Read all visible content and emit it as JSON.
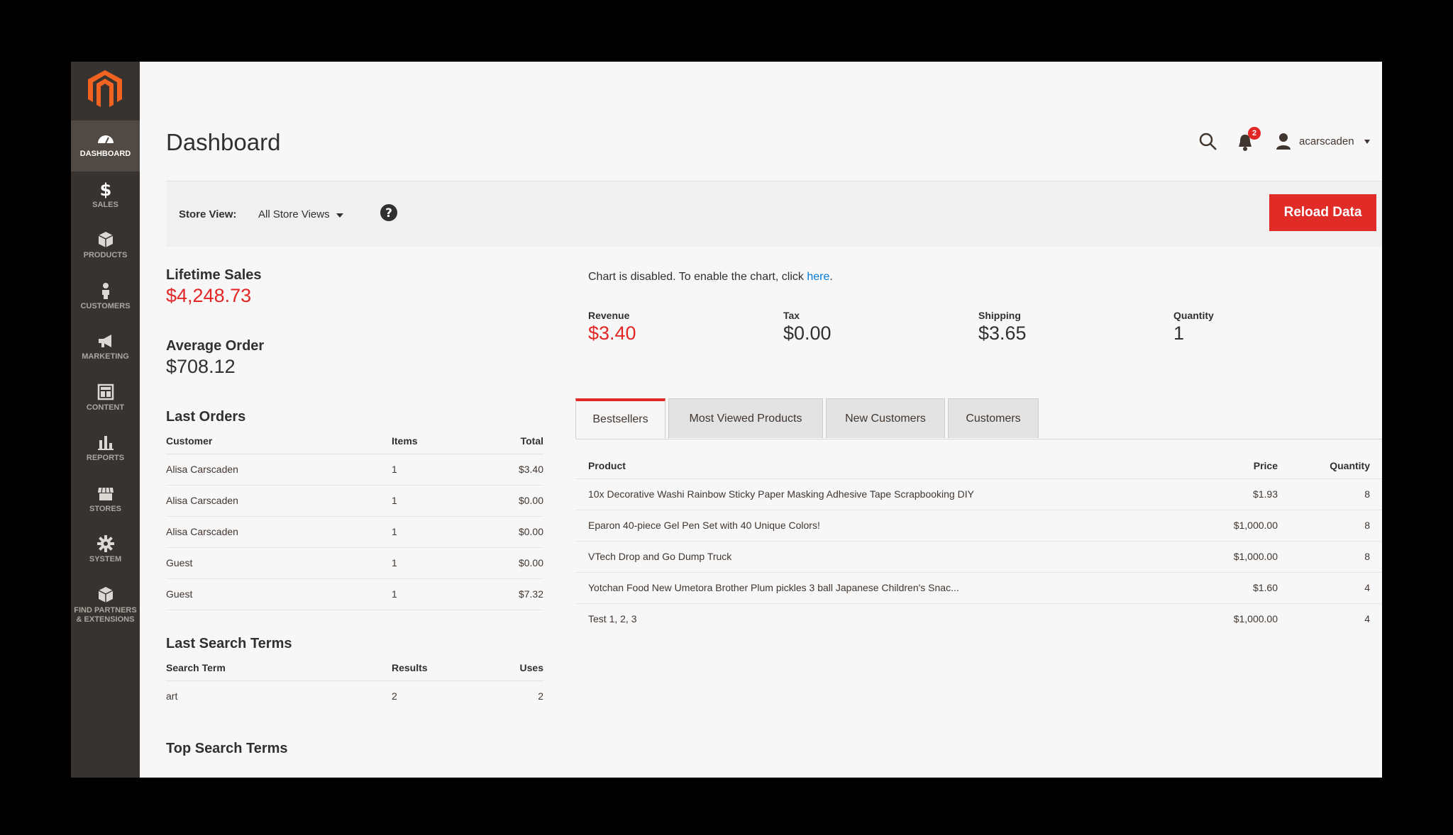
{
  "sidebar": {
    "items": [
      {
        "label": "DASHBOARD",
        "icon": "dashboard-icon"
      },
      {
        "label": "SALES",
        "icon": "dollar-icon"
      },
      {
        "label": "PRODUCTS",
        "icon": "box-icon"
      },
      {
        "label": "CUSTOMERS",
        "icon": "person-icon"
      },
      {
        "label": "MARKETING",
        "icon": "megaphone-icon"
      },
      {
        "label": "CONTENT",
        "icon": "layout-icon"
      },
      {
        "label": "REPORTS",
        "icon": "bar-chart-icon"
      },
      {
        "label": "STORES",
        "icon": "storefront-icon"
      },
      {
        "label": "SYSTEM",
        "icon": "gear-icon"
      },
      {
        "label": "FIND PARTNERS",
        "label2": "& EXTENSIONS",
        "icon": "cube-icon"
      }
    ]
  },
  "header": {
    "title": "Dashboard",
    "notification_count": "2",
    "username": "acarscaden"
  },
  "storebar": {
    "label": "Store View:",
    "selected": "All Store Views",
    "reload_label": "Reload Data"
  },
  "stats": {
    "lifetime_label": "Lifetime Sales",
    "lifetime_value": "$4,248.73",
    "avg_label": "Average Order",
    "avg_value": "$708.12"
  },
  "last_orders": {
    "title": "Last Orders",
    "headers": [
      "Customer",
      "Items",
      "Total"
    ],
    "rows": [
      [
        "Alisa Carscaden",
        "1",
        "$3.40"
      ],
      [
        "Alisa Carscaden",
        "1",
        "$0.00"
      ],
      [
        "Alisa Carscaden",
        "1",
        "$0.00"
      ],
      [
        "Guest",
        "1",
        "$0.00"
      ],
      [
        "Guest",
        "1",
        "$7.32"
      ]
    ]
  },
  "last_search": {
    "title": "Last Search Terms",
    "headers": [
      "Search Term",
      "Results",
      "Uses"
    ],
    "rows": [
      [
        "art",
        "2",
        "2"
      ]
    ]
  },
  "top_search": {
    "title": "Top Search Terms"
  },
  "chart": {
    "message": "Chart is disabled. To enable the chart, click ",
    "link": "here",
    "tail": "."
  },
  "totals": [
    {
      "label": "Revenue",
      "value": "$3.40"
    },
    {
      "label": "Tax",
      "value": "$0.00"
    },
    {
      "label": "Shipping",
      "value": "$3.65"
    },
    {
      "label": "Quantity",
      "value": "1"
    }
  ],
  "tabs": [
    "Bestsellers",
    "Most Viewed Products",
    "New Customers",
    "Customers"
  ],
  "bestsellers": {
    "headers": [
      "Product",
      "Price",
      "Quantity"
    ],
    "rows": [
      [
        "10x Decorative Washi Rainbow Sticky Paper Masking Adhesive Tape Scrapbooking DIY",
        "$1.93",
        "8"
      ],
      [
        "Eparon 40-piece Gel Pen Set with 40 Unique Colors!",
        "$1,000.00",
        "8"
      ],
      [
        "VTech Drop and Go Dump Truck",
        "$1,000.00",
        "8"
      ],
      [
        "Yotchan Food New Umetora Brother Plum pickles 3 ball Japanese Children's Snac...",
        "$1.60",
        "4"
      ],
      [
        "Test 1, 2, 3",
        "$1,000.00",
        "4"
      ]
    ]
  },
  "colors": {
    "accent": "#e02b27",
    "sidebar": "#373330",
    "link": "#007bdb"
  }
}
